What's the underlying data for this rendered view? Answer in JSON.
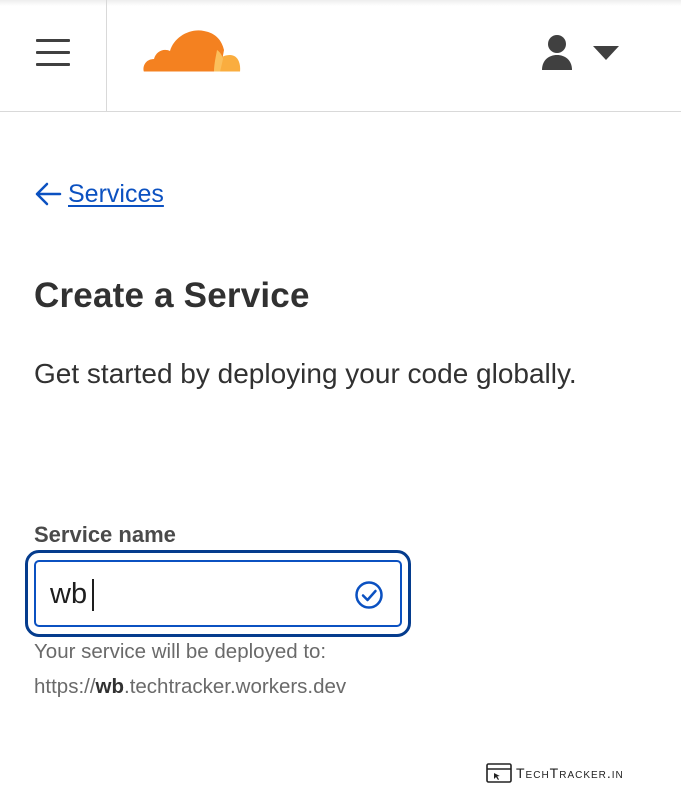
{
  "header": {
    "menu_icon": "hamburger-menu-icon",
    "logo": "cloudflare-logo",
    "user_icon": "user-icon",
    "dropdown_icon": "caret-down-icon",
    "colors": {
      "logo_orange": "#f48120",
      "logo_light_orange": "#faad3f",
      "border": "#d9d9d9"
    }
  },
  "nav": {
    "back_label": "Services",
    "back_icon": "arrow-left-icon",
    "link_color": "#0b51c1"
  },
  "main": {
    "title": "Create a Service",
    "subtitle": "Get started by deploying your code globally."
  },
  "form": {
    "service_name_label": "Service name",
    "service_name_value": "wb",
    "valid_icon": "check-circle-icon",
    "focus_color": "#053c8d",
    "help_prefix": "Your service will be deployed to:",
    "url_scheme": "https://",
    "url_name": "wb",
    "url_suffix": ".techtracker.workers.dev"
  },
  "watermark": {
    "text": "TechTracker.in",
    "icon": "browser-window-icon"
  }
}
